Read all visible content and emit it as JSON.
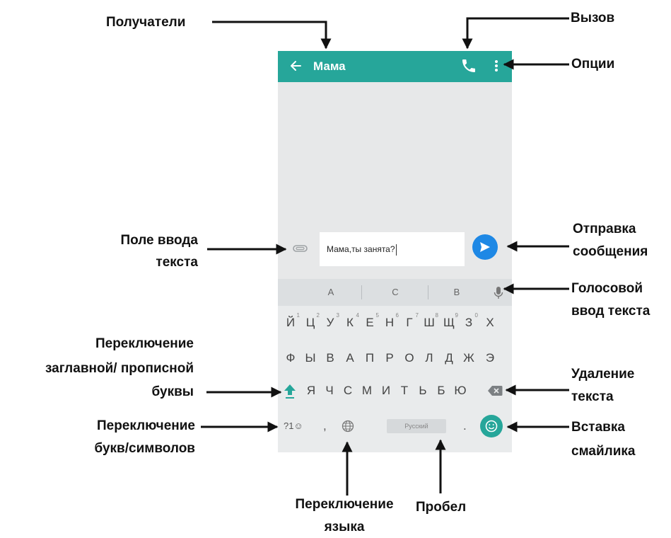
{
  "callouts": {
    "recipients": "Получатели",
    "call": "Вызов",
    "options": "Опции",
    "input_field_line1": "Поле ввода",
    "input_field_line2": "текста",
    "send_line1": "Отправка",
    "send_line2": "сообщения",
    "voice_line1": "Голосовой",
    "voice_line2": "ввод текста",
    "case_line1": "Переключение",
    "case_line2": "заглавной/ прописной",
    "case_line3": "буквы",
    "delete_line1": "Удаление",
    "delete_line2": "текста",
    "symbols_line1": "Переключение",
    "symbols_line2": "букв/символов",
    "emoji_line1": "Вставка",
    "emoji_line2": "смайлика",
    "language_line1": "Переключение",
    "language_line2": "языка",
    "space": "Пробел"
  },
  "appbar": {
    "back_icon": "arrow-left-icon",
    "title": "Мама",
    "call_icon": "phone-icon",
    "more_icon": "more-vertical-icon",
    "color": "#26a69a"
  },
  "compose": {
    "attach_icon": "paperclip-icon",
    "text": "Мама,ты занята?",
    "send_icon": "send-icon",
    "send_color": "#1e88e5"
  },
  "suggestions": {
    "items": [
      "А",
      "С",
      "В"
    ],
    "mic_icon": "microphone-icon"
  },
  "keyboard": {
    "row1": [
      {
        "k": "Й",
        "h": "1"
      },
      {
        "k": "Ц",
        "h": "2"
      },
      {
        "k": "У",
        "h": "3"
      },
      {
        "k": "К",
        "h": "4"
      },
      {
        "k": "Е",
        "h": "5"
      },
      {
        "k": "Н",
        "h": "6"
      },
      {
        "k": "Г",
        "h": "7"
      },
      {
        "k": "Ш",
        "h": "8"
      },
      {
        "k": "Щ",
        "h": "9"
      },
      {
        "k": "З",
        "h": "0"
      },
      {
        "k": "Х",
        "h": ""
      }
    ],
    "row2": [
      "Ф",
      "Ы",
      "В",
      "А",
      "П",
      "Р",
      "О",
      "Л",
      "Д",
      "Ж",
      "Э"
    ],
    "row3": [
      "Я",
      "Ч",
      "С",
      "М",
      "И",
      "Т",
      "Ь",
      "Б",
      "Ю"
    ],
    "shift_icon": "shift-arrow-icon",
    "delete_icon": "backspace-icon",
    "symbols": "?1☺",
    "comma": ",",
    "globe_icon": "globe-icon",
    "space_label": "Русский",
    "period": ".",
    "emoji_icon": "smiley-icon",
    "accent": "#26a69a"
  }
}
